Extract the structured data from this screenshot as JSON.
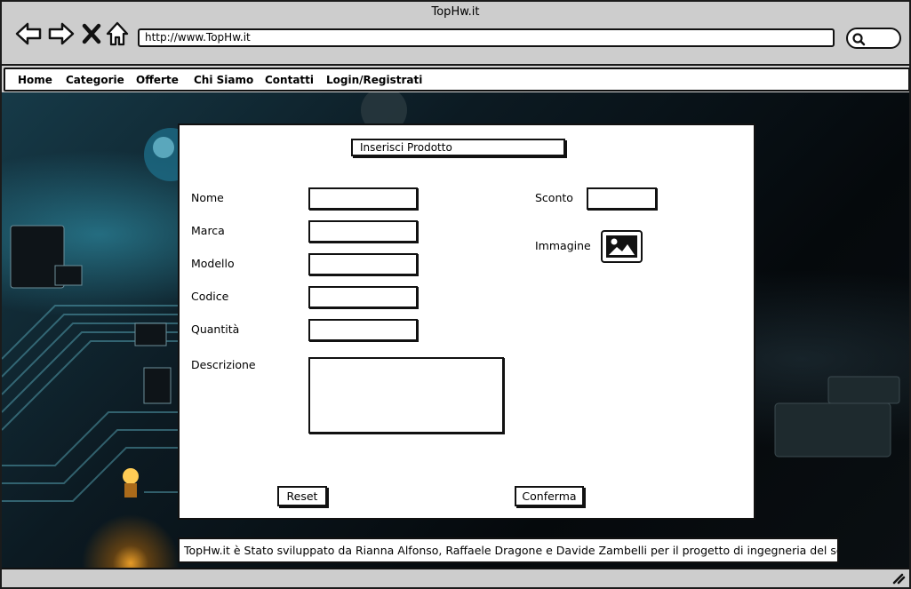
{
  "window": {
    "title": "TopHw.it"
  },
  "toolbar": {
    "url": "http://www.TopHw.it",
    "icons": [
      "back-arrow-icon",
      "forward-arrow-icon",
      "close-x-icon",
      "home-icon",
      "search-icon"
    ]
  },
  "menu": {
    "items": [
      {
        "label": "Home"
      },
      {
        "label": "Categorie"
      },
      {
        "label": "Offerte"
      },
      {
        "label": "Chi Siamo"
      },
      {
        "label": "Contatti"
      },
      {
        "label": "Login/Registrati"
      }
    ]
  },
  "form": {
    "title": "Inserisci Prodotto",
    "fields": [
      {
        "label": "Nome",
        "value": ""
      },
      {
        "label": "Marca",
        "value": ""
      },
      {
        "label": "Modello",
        "value": ""
      },
      {
        "label": "Codice",
        "value": ""
      },
      {
        "label": "Quantità",
        "value": ""
      },
      {
        "label": "Descrizione",
        "value": ""
      }
    ],
    "discount": {
      "label": "Sconto",
      "value": ""
    },
    "image": {
      "label": "Immagine",
      "icon": "image-placeholder-icon"
    },
    "reset_label": "Reset",
    "confirm_label": "Conferma"
  },
  "footer": {
    "text": "TopHw.it è Stato sviluppato da Rianna Alfonso, Raffaele Dragone e Davide Zambelli per il progetto di ingegneria del software"
  },
  "colors": {
    "chrome": "#cdcdcd",
    "border": "#111111",
    "panel": "#ffffff",
    "background_dark": "#0c1a22",
    "accent_cyan": "#3cbedc",
    "led_orange": "#ffaa28"
  }
}
